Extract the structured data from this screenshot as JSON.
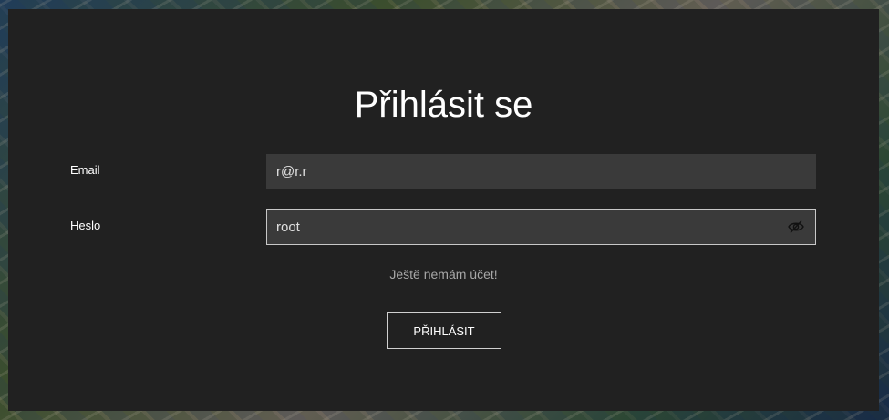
{
  "login": {
    "title": "Přihlásit se",
    "email_label": "Email",
    "email_value": "r@r.r",
    "password_label": "Heslo",
    "password_value": "root",
    "password_toggle_icon": "eye-slash-icon",
    "register_link": "Ještě nemám účet!",
    "submit_label": "PŘIHLÁSIT"
  },
  "colors": {
    "panel_background": "#212121",
    "input_background": "#3a3a3a",
    "text_primary": "#ffffff",
    "text_muted": "#a8a8a8"
  }
}
